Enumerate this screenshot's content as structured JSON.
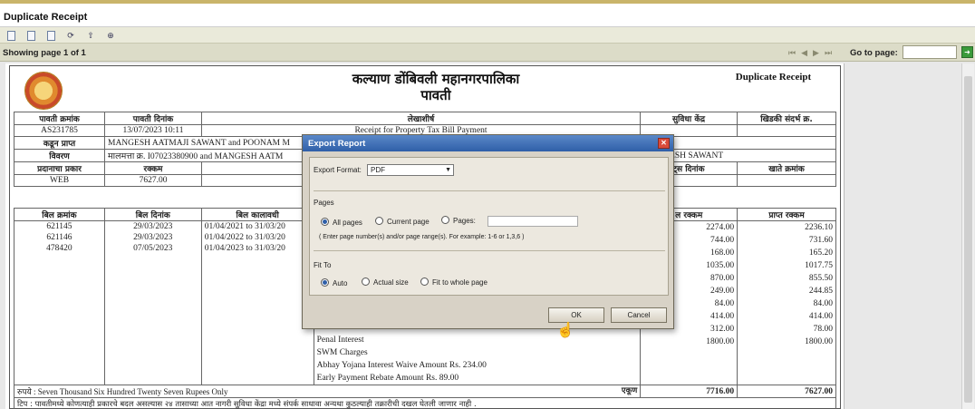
{
  "window": {
    "title": "Duplicate Receipt"
  },
  "toolbar": {
    "icons": [
      "export-icon",
      "print-icon",
      "first-page-icon",
      "refresh-icon",
      "upload-icon",
      "zoom-icon"
    ]
  },
  "pager": {
    "showing": "Showing page  1  of  1",
    "goto_label": "Go to page:",
    "goto_value": ""
  },
  "receipt": {
    "org_name": "कल्याण डोंबिवली महानगरपालिका",
    "doc_name": "पावती",
    "duplicate_label": "Duplicate Receipt",
    "headers1": {
      "receipt_no": "पावती क्रमांक",
      "receipt_date": "पावती दिनांक",
      "account_head": "लेखाशीर्ष",
      "facility_center": "सुविधा केंद्र",
      "window_ref": "खिडकी संदर्भ क्र."
    },
    "row1": {
      "receipt_no": "AS231785",
      "receipt_date": "13/07/2023 10:11",
      "account_head": "Receipt for  Property Tax Bill Payment"
    },
    "received_from_label": "कडून प्राप्त",
    "received_from": "MANGESH AATMAJI SAWANT and POONAM M",
    "details_label": "विवरण",
    "details": "मालमत्ता क्र. I07023380900 and MANGESH AATM",
    "details_right": "MANGESH SAWANT",
    "headers2": {
      "payment_type": "प्रदानाचा प्रकार",
      "amount": "रक्कम",
      "date_right": "ट्स दिनांक",
      "account_no": "खाते क्रमांक"
    },
    "row2": {
      "payment_type": "WEB",
      "amount": "7627.00"
    },
    "headers3": {
      "bill_no": "बिल क्रमांक",
      "bill_date": "बिल दिनांक",
      "bill_period": "बिल कालावधी",
      "bill_amount": "ल रक्कम",
      "received_amount": "प्राप्त रक्कम"
    },
    "bills": [
      {
        "no": "621145",
        "date": "29/03/2023",
        "period": "01/04/2021 to 31/03/20"
      },
      {
        "no": "621146",
        "date": "29/03/2023",
        "period": "01/04/2022 to 31/03/20"
      },
      {
        "no": "478420",
        "date": "07/05/2023",
        "period": "01/04/2023 to 31/03/20"
      }
    ],
    "amounts": [
      {
        "bill": "2274.00",
        "received": "2236.10"
      },
      {
        "bill": "744.00",
        "received": "731.60"
      },
      {
        "bill": "168.00",
        "received": "165.20"
      },
      {
        "bill": "1035.00",
        "received": "1017.75"
      },
      {
        "bill": "870.00",
        "received": "855.50"
      },
      {
        "bill": "249.00",
        "received": "244.85"
      },
      {
        "bill": "84.00",
        "received": "84.00"
      },
      {
        "bill": "414.00",
        "received": "414.00"
      },
      {
        "bill": "312.00",
        "received": "78.00"
      },
      {
        "bill": "1800.00",
        "received": "1800.00"
      }
    ],
    "charges": [
      "Penal Interest",
      "SWM Charges",
      "Abhay Yojana Interest Waive Amount Rs. 234.00",
      "Early Payment Rebate Amount Rs. 89.00"
    ],
    "words": "रुपये :  Seven Thousand Six Hundred Twenty Seven Rupees Only",
    "total_label": "एकूण",
    "total_bill": "7716.00",
    "total_received": "7627.00",
    "note": "टिप : पावतीमध्ये कोणत्याही प्रकारचे बदल असल्यास २४ तासाच्या आत नागरी सुविधा केंद्रा मध्ये संपर्क साधावा अन्यथा कुठल्याही तक्रारीची दखल घेतली जाणार नाही ."
  },
  "dialog": {
    "title": "Export Report",
    "format_label": "Export Format:",
    "format_value": "PDF",
    "pages_label": "Pages",
    "all_pages": "All pages",
    "current_page": "Current page",
    "pages_opt": "Pages:",
    "pages_value": "",
    "pages_hint": "( Enter page number(s) and/or page range(s). For example: 1-6 or 1,3,6 )",
    "fit_label": "Fit To",
    "fit_auto": "Auto",
    "fit_actual": "Actual size",
    "fit_whole": "Fit to whole page",
    "ok": "OK",
    "cancel": "Cancel"
  }
}
